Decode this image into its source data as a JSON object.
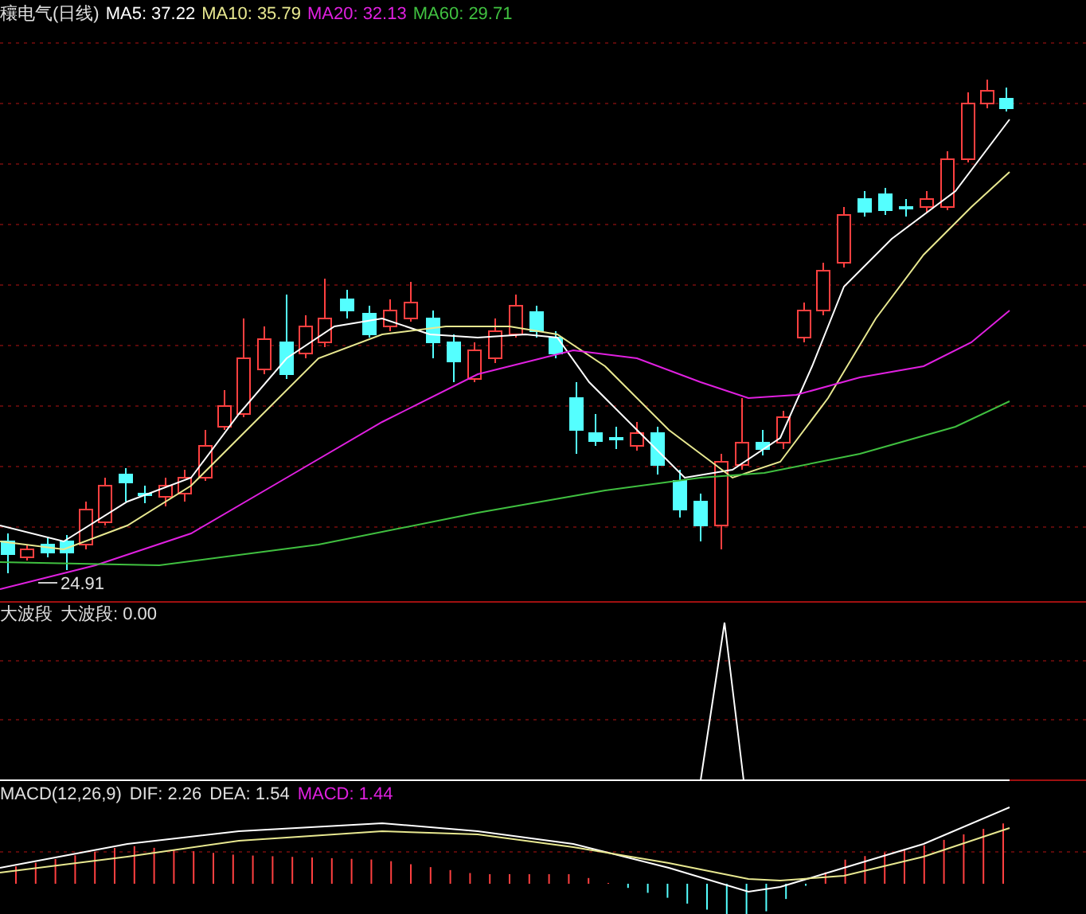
{
  "price_panel": {
    "stock": "穰电气(日线)",
    "ma_lines": [
      {
        "label": "MA5: 37.22",
        "color": "#ffffff"
      },
      {
        "label": "MA10: 35.79",
        "color": "#e8e890"
      },
      {
        "label": "MA20: 32.13",
        "color": "#e020e0"
      },
      {
        "label": "MA60: 29.71",
        "color": "#40c040"
      }
    ],
    "low_label": "24.91"
  },
  "indicator_panel": {
    "labels": [
      "大波段",
      "大波段: 0.00"
    ]
  },
  "macd_panel": {
    "labels": [
      {
        "text": "MACD(12,26,9)",
        "color": "#e0e0e0"
      },
      {
        "text": "DIF: 2.26",
        "color": "#e0e0e0"
      },
      {
        "text": "DEA: 1.54",
        "color": "#e0e0e0"
      },
      {
        "text": "MACD: 1.44",
        "color": "#e020e0"
      }
    ]
  }
}
